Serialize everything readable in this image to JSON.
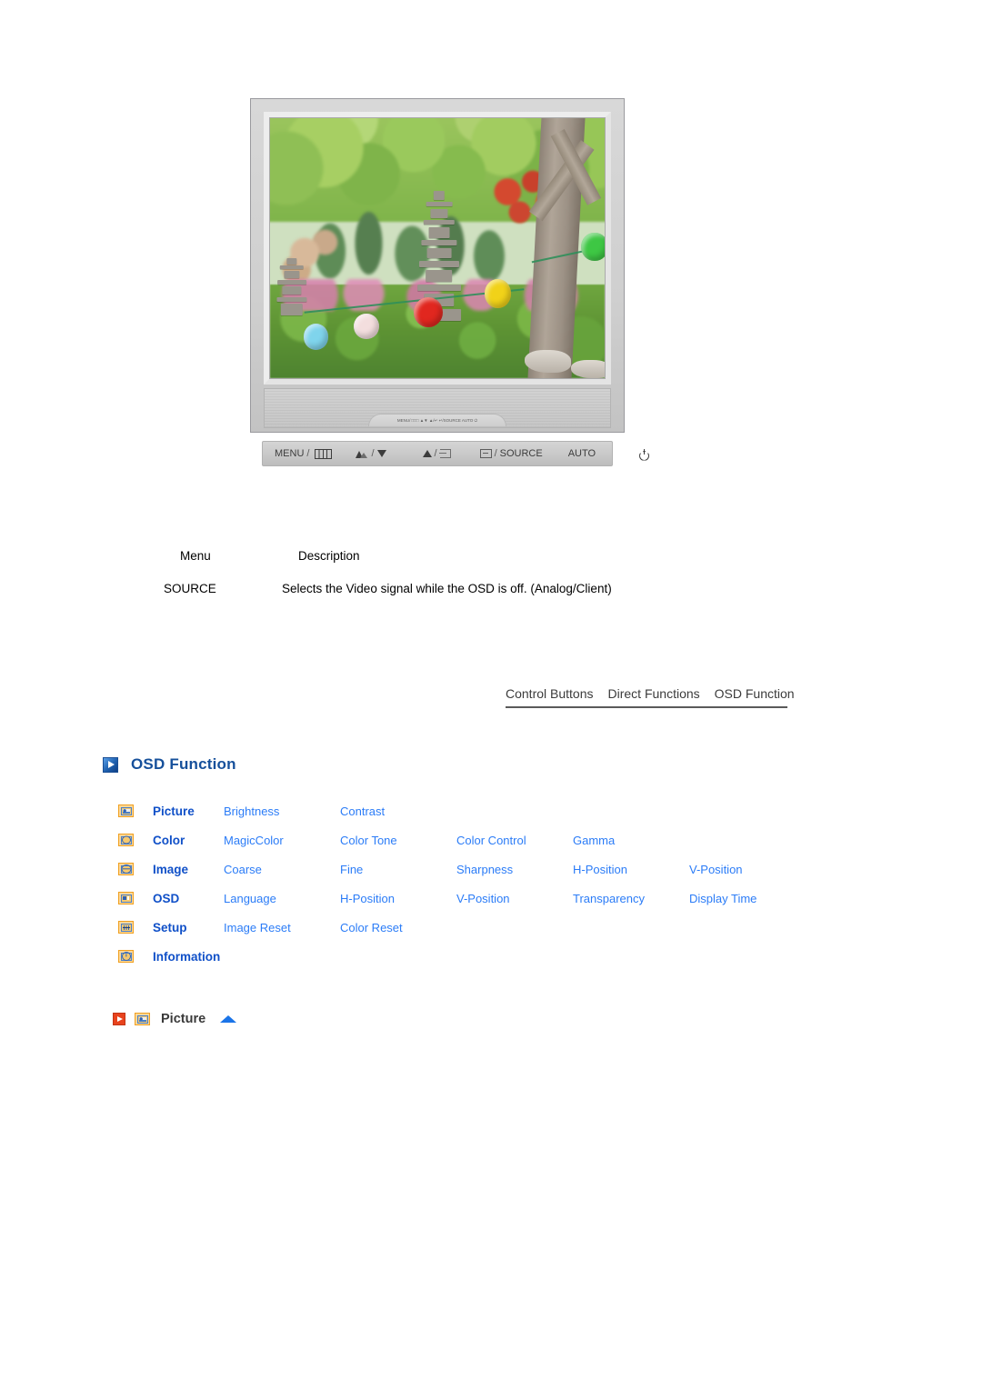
{
  "monitor": {
    "caption_alt": "LCD monitor displaying a garden scene with a stone pagoda and colorful paper lanterns",
    "bottom_bezel_button_strip": "MENU/ □□□  ▲▼  ▲/↵  ↵/SOURCE  AUTO  ⏻"
  },
  "control_bar": {
    "buttons": [
      {
        "label": "MENU",
        "icon": "osd-grid-icon",
        "separator": "/"
      },
      {
        "label": "",
        "icon": "mountain-brightness-icon",
        "separator": "/",
        "icon2": "triangle-down-icon"
      },
      {
        "label": "",
        "icon": "triangle-up-icon",
        "separator": "/",
        "icon2": "exit-icon"
      },
      {
        "label": "SOURCE",
        "icon": "enter-icon",
        "separator": "/"
      },
      {
        "label": "AUTO",
        "icon": ""
      },
      {
        "label": "",
        "icon": "power-icon"
      }
    ]
  },
  "menu_table": {
    "headers": {
      "menu": "Menu",
      "description": "Description"
    },
    "rows": [
      {
        "menu": "SOURCE",
        "description": "Selects the Video signal while the OSD is off. (Analog/Client)"
      }
    ]
  },
  "tabs": [
    {
      "label": "Control Buttons"
    },
    {
      "label": "Direct Functions"
    },
    {
      "label": "OSD Function"
    }
  ],
  "section": {
    "heading": "OSD Function",
    "heading_icon": "blue-arrow-icon"
  },
  "osd_table": {
    "rows": [
      {
        "icon": "picture-icon",
        "category": "Picture",
        "links": [
          "Brightness",
          "Contrast"
        ]
      },
      {
        "icon": "color-icon",
        "category": "Color",
        "links": [
          "MagicColor",
          "Color Tone",
          "Color Control",
          "Gamma"
        ]
      },
      {
        "icon": "image-icon",
        "category": "Image",
        "links": [
          "Coarse",
          "Fine",
          "Sharpness",
          "H-Position",
          "V-Position"
        ]
      },
      {
        "icon": "osd-icon",
        "category": "OSD",
        "links": [
          "Language",
          "H-Position",
          "V-Position",
          "Transparency",
          "Display Time"
        ]
      },
      {
        "icon": "setup-icon",
        "category": "Setup",
        "links": [
          "Image Reset",
          "Color Reset"
        ]
      },
      {
        "icon": "information-icon",
        "category": "Information",
        "links": []
      }
    ]
  },
  "picture_subsection": {
    "title": "Picture",
    "red_icon": "red-arrow-icon",
    "category_icon": "picture-icon",
    "top_arrow_icon": "blue-up-triangle-icon"
  },
  "colors": {
    "heading_blue": "#16509b",
    "category_blue": "#1050c8",
    "link_blue": "#2b7cf7",
    "icon_orange": "#f0a020",
    "red_accent": "#e8431d",
    "text_black": "#000000"
  }
}
